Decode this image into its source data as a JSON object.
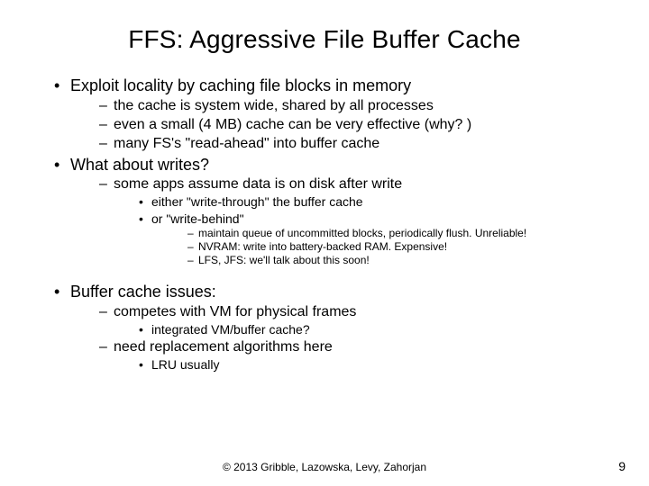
{
  "title": "FFS:  Aggressive File Buffer Cache",
  "bullets": {
    "b1": "Exploit locality by caching file blocks in memory",
    "b1_1": "the cache is system wide, shared by all processes",
    "b1_2": "even a small (4 MB) cache can be very effective (why? )",
    "b1_3": "many FS's \"read-ahead\" into buffer cache",
    "b2": "What about writes?",
    "b2_1": "some apps assume data is on disk after write",
    "b2_1_1": "either \"write-through\" the buffer cache",
    "b2_1_2": "or \"write-behind\"",
    "b2_1_2_1": "maintain queue of uncommitted blocks, periodically flush.  Unreliable!",
    "b2_1_2_2": "NVRAM: write into battery-backed RAM.  Expensive!",
    "b2_1_2_3": "LFS, JFS: we'll talk about this soon!",
    "b3": "Buffer cache issues:",
    "b3_1": "competes with VM for physical frames",
    "b3_1_1": "integrated VM/buffer cache?",
    "b3_2": "need replacement algorithms here",
    "b3_2_1": "LRU usually"
  },
  "footer": "© 2013 Gribble, Lazowska, Levy, Zahorjan",
  "page_number": "9"
}
